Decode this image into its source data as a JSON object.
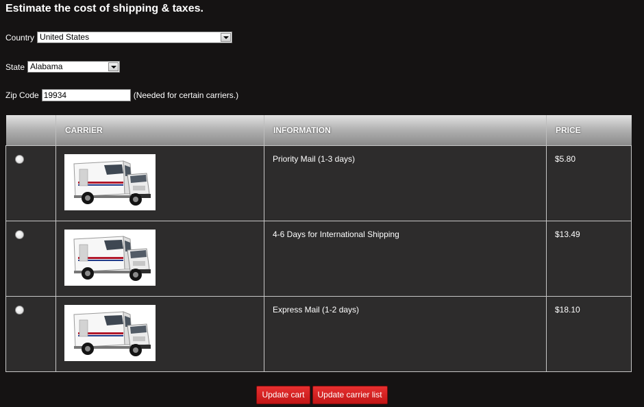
{
  "heading": "Estimate the cost of shipping & taxes.",
  "country": {
    "label": "Country",
    "selected": "United States"
  },
  "state": {
    "label": "State",
    "selected": "Alabama"
  },
  "zip": {
    "label": "Zip Code",
    "value": "19934",
    "note": "(Needed for certain carriers.)"
  },
  "table": {
    "headers": {
      "carrier": "CARRIER",
      "information": "INFORMATION",
      "price": "PRICE"
    },
    "rows": [
      {
        "info": "Priority Mail (1-3 days)",
        "price": "$5.80",
        "icon": "mail-truck-image",
        "selected": false
      },
      {
        "info": "4-6 Days for International Shipping",
        "price": "$13.49",
        "icon": "mail-truck-image",
        "selected": false
      },
      {
        "info": "Express Mail (1-2 days)",
        "price": "$18.10",
        "icon": "mail-truck-image",
        "selected": false
      }
    ]
  },
  "buttons": {
    "update_cart": "Update cart",
    "update_carrier_list": "Update carrier list"
  },
  "colors": {
    "background": "#151313",
    "row_bg": "#2d2c2c",
    "button": "#d42020"
  }
}
